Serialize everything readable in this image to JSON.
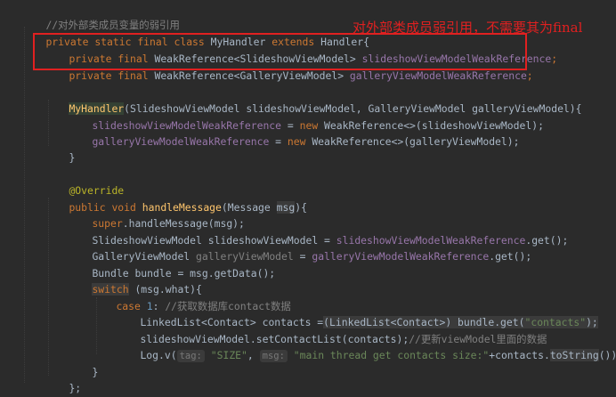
{
  "code": {
    "l1_comment": "//对外部类成员变量的弱引用",
    "l2_private": "private",
    "l2_static": "static",
    "l2_final": "final",
    "l2_class": "class",
    "l2_name": "MyHandler",
    "l2_extends": "extends",
    "l2_super": "Handler{",
    "l3_private": "private",
    "l3_final": "final",
    "l3_type": "WeakReference<SlideshowViewModel>",
    "l3_field": "slideshowViewModelWeakReference",
    "l3_end": ";",
    "l4_private": "private",
    "l4_final": "final",
    "l4_type": "WeakReference<GalleryViewModel>",
    "l4_field": "galleryViewModelWeakReference",
    "l4_end": ";",
    "l6_ctor": "MyHandler",
    "l6_params": "(SlideshowViewModel slideshowViewModel, GalleryViewModel galleryViewModel){",
    "l7_field": "slideshowViewModelWeakReference",
    "l7_eq": " = ",
    "l7_new": "new",
    "l7_rest": " WeakReference<>(slideshowViewModel);",
    "l8_field": "galleryViewModelWeakReference",
    "l8_eq": " = ",
    "l8_new": "new",
    "l8_rest": " WeakReference<>(galleryViewModel);",
    "l9_close": "}",
    "l11_ann": "@Override",
    "l12_public": "public",
    "l12_void": "void",
    "l12_method": "handleMessage",
    "l12_params_a": "(Message ",
    "l12_msg": "msg",
    "l12_params_b": "){",
    "l13_super": "super",
    "l13_rest": ".handleMessage(msg);",
    "l14_type": "SlideshowViewModel slideshowViewModel = ",
    "l14_field": "slideshowViewModelWeakReference",
    "l14_rest": ".get();",
    "l15_type": "GalleryViewModel ",
    "l15_var": "galleryViewModel",
    "l15_eq": " = ",
    "l15_field": "galleryViewModelWeakReference",
    "l15_rest": ".get();",
    "l16_code": "Bundle bundle = msg.getData();",
    "l17_switch": "switch",
    "l17_rest": " (msg.what){",
    "l18_case": "case",
    "l18_num": "1",
    "l18_colon": ": ",
    "l18_comment": "//获取数据库contact数据",
    "l19_a": "LinkedList<Contact> contacts =",
    "l19_cast": "(LinkedList<Contact>) bundle.get(",
    "l19_str": "\"contacts\"",
    "l19_end": ");",
    "l20_code": "slideshowViewModel.setContactList(contacts);",
    "l20_comment": "//更新viewModel里面的数据",
    "l21_a": "Log.v(",
    "l21_hint1": "tag:",
    "l21_str1": "\"SIZE\"",
    "l21_comma": ", ",
    "l21_hint2": "msg:",
    "l21_str2": "\"main thread get contacts size:\"",
    "l21_plus": "+contacts.",
    "l21_method": "toString",
    "l21_end": "());",
    "l22_close": "}",
    "l23_close": "};",
    "l24_close": "};"
  },
  "annotation": {
    "note": "对外部类成员弱引用，不需要其为final",
    "color": "#e02020"
  },
  "colors": {
    "background": "#2b2b2b",
    "keyword": "#cc7832",
    "field": "#9876aa",
    "string": "#6a8759",
    "comment": "#808080",
    "annotation": "#bbb529",
    "method": "#ffc66d"
  }
}
